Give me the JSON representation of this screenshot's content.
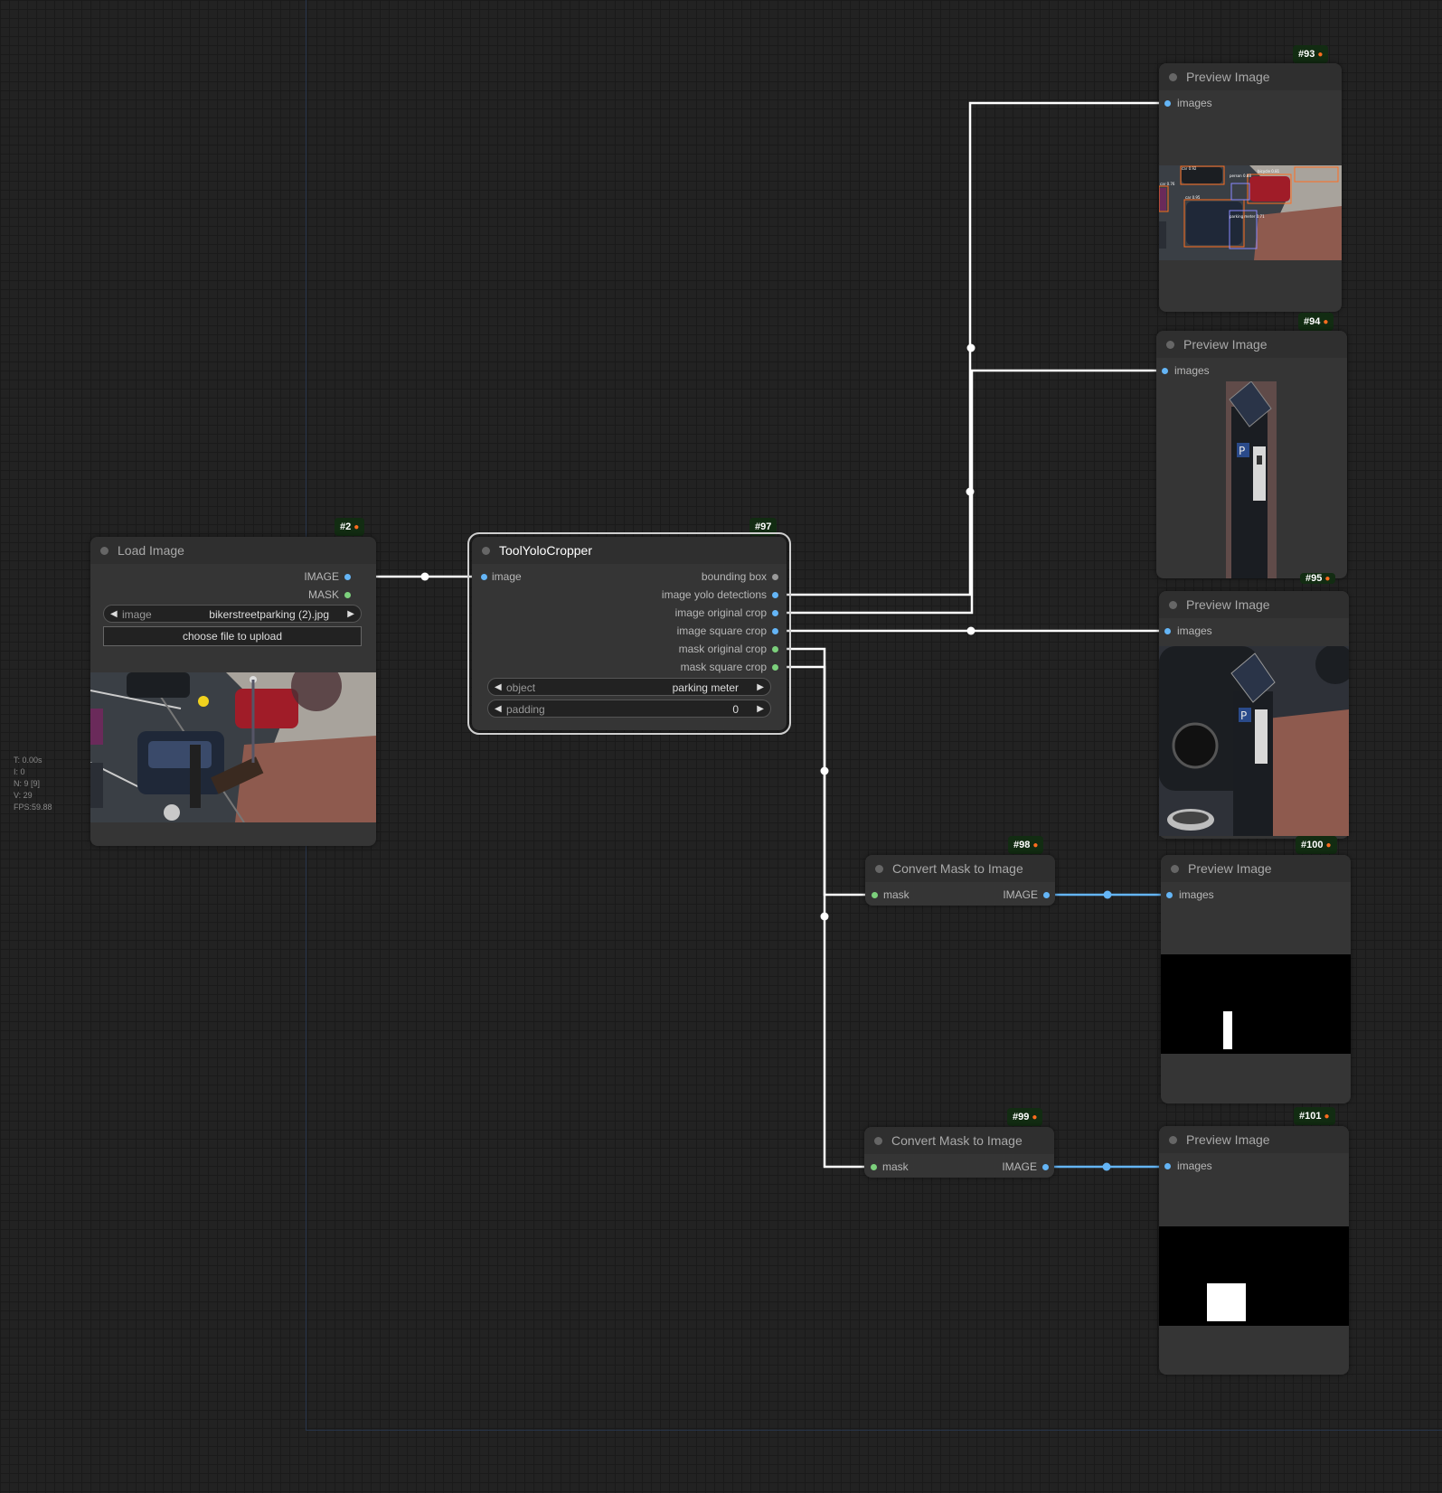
{
  "stats": [
    "T: 0.00s",
    "I: 0",
    "N: 9 [9]",
    "V: 29",
    "FPS:59.88"
  ],
  "nodes": {
    "load_image": {
      "id": "#2",
      "title": "Load Image",
      "outputs": [
        "IMAGE",
        "MASK"
      ],
      "widget_image_label": "image",
      "widget_image_value": "bikerstreetparking (2).jpg",
      "upload_button": "choose file to upload"
    },
    "cropper": {
      "id": "#97",
      "title": "ToolYoloCropper",
      "input": "image",
      "outputs": [
        "bounding box",
        "image yolo detections",
        "image original crop",
        "image square crop",
        "mask original crop",
        "mask square crop"
      ],
      "widget_object_label": "object",
      "widget_object_value": "parking meter",
      "widget_padding_label": "padding",
      "widget_padding_value": "0"
    },
    "preview_93": {
      "id": "#93",
      "title": "Preview Image",
      "input": "images"
    },
    "preview_94": {
      "id": "#94",
      "title": "Preview Image",
      "input": "images"
    },
    "preview_95": {
      "id": "#95",
      "title": "Preview Image",
      "input": "images"
    },
    "preview_100": {
      "id": "#100",
      "title": "Preview Image",
      "input": "images"
    },
    "preview_101": {
      "id": "#101",
      "title": "Preview Image",
      "input": "images"
    },
    "convert_98": {
      "id": "#98",
      "title": "Convert Mask to Image",
      "input": "mask",
      "output": "IMAGE"
    },
    "convert_99": {
      "id": "#99",
      "title": "Convert Mask to Image",
      "input": "mask",
      "output": "IMAGE"
    }
  },
  "detection_labels": [
    "car 0.92",
    "person 0.88",
    "bicycle 0.81",
    "car 0.76",
    "car 0.95",
    "parking meter 0.71"
  ],
  "colors": {
    "canvas": "#222222",
    "node": "#353535",
    "link_white": "#ffffff",
    "link_blue": "#64b5f6",
    "badge_bg": "#122c12",
    "badge_icon": "#ff6d1f"
  }
}
